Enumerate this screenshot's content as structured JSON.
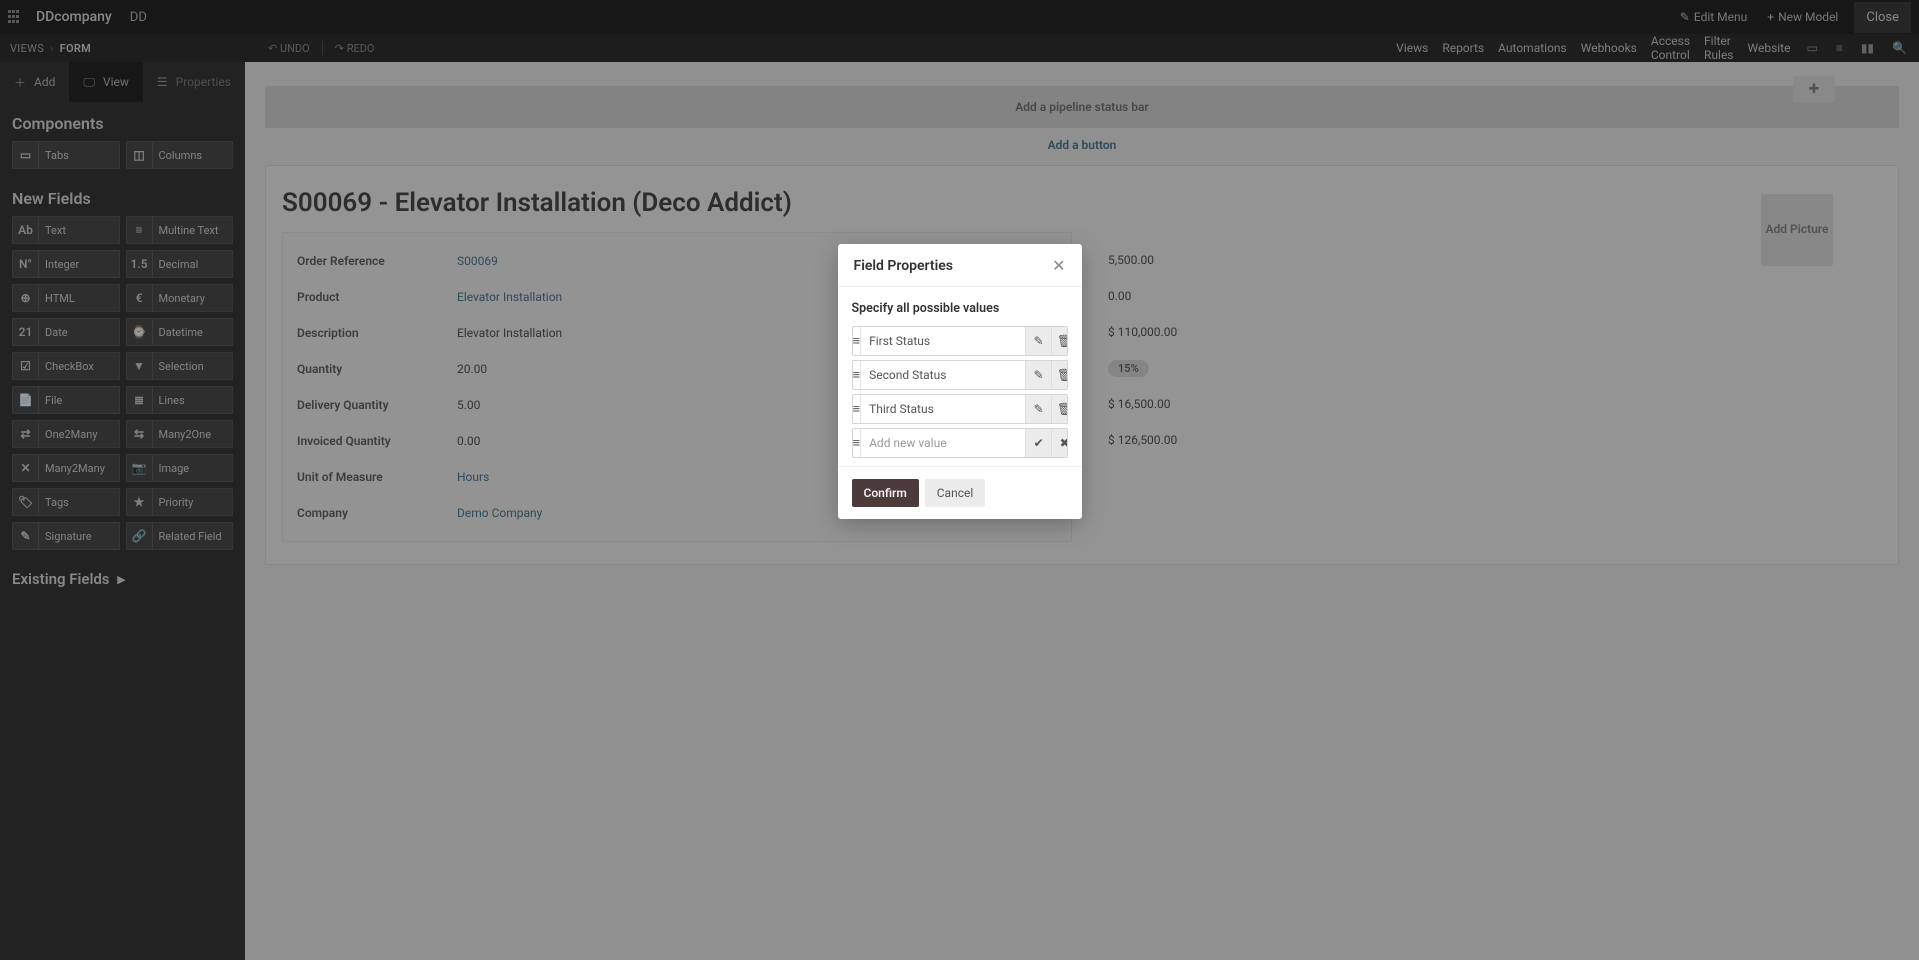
{
  "header": {
    "company": "DDcompany",
    "env": "DD",
    "edit_menu": "Edit Menu",
    "new_model": "New Model",
    "close": "Close"
  },
  "secondary": {
    "crumb_views": "VIEWS",
    "crumb_current": "FORM",
    "undo": "UNDO",
    "redo": "REDO",
    "links": [
      "Views",
      "Reports",
      "Automations",
      "Webhooks",
      "Access Control",
      "Filter Rules",
      "Website"
    ]
  },
  "sidebar": {
    "tabs": {
      "add": "Add",
      "view": "View",
      "properties": "Properties"
    },
    "components_title": "Components",
    "components": {
      "tabs": "Tabs",
      "columns": "Columns"
    },
    "new_fields_title": "New Fields",
    "fields": [
      {
        "icon": "Ab",
        "label": "Text"
      },
      {
        "icon": "≡",
        "label": "Multine Text"
      },
      {
        "icon": "N°",
        "label": "Integer"
      },
      {
        "icon": "1.5",
        "label": "Decimal"
      },
      {
        "icon": "⊕",
        "label": "HTML"
      },
      {
        "icon": "€",
        "label": "Monetary"
      },
      {
        "icon": "21",
        "label": "Date"
      },
      {
        "icon": "⌚",
        "label": "Datetime"
      },
      {
        "icon": "☑",
        "label": "CheckBox"
      },
      {
        "icon": "▼",
        "label": "Selection"
      },
      {
        "icon": "📄",
        "label": "File"
      },
      {
        "icon": "≣",
        "label": "Lines"
      },
      {
        "icon": "⇄",
        "label": "One2Many"
      },
      {
        "icon": "⇆",
        "label": "Many2One"
      },
      {
        "icon": "✕",
        "label": "Many2Many"
      },
      {
        "icon": "📷",
        "label": "Image"
      },
      {
        "icon": "🏷",
        "label": "Tags"
      },
      {
        "icon": "★",
        "label": "Priority"
      },
      {
        "icon": "✎",
        "label": "Signature"
      },
      {
        "icon": "🔗",
        "label": "Related Field"
      }
    ],
    "existing_fields": "Existing Fields"
  },
  "canvas": {
    "pipeline_hint": "Add a pipeline status bar",
    "add_button": "Add a button",
    "title": "S00069 - Elevator Installation (Deco Addict)",
    "add_picture": "Add Picture",
    "left_fields": [
      {
        "label": "Order Reference",
        "value": "S00069",
        "link": true
      },
      {
        "label": "Product",
        "value": "Elevator Installation",
        "link": true
      },
      {
        "label": "Description",
        "value": "Elevator Installation",
        "link": false
      },
      {
        "label": "Quantity",
        "value": "20.00",
        "link": false
      },
      {
        "label": "Delivery Quantity",
        "value": "5.00",
        "link": false
      },
      {
        "label": "Invoiced Quantity",
        "value": "0.00",
        "link": false
      },
      {
        "label": "Unit of Measure",
        "value": "Hours",
        "link": true
      },
      {
        "label": "Company",
        "value": "Demo Company",
        "link": true
      }
    ],
    "right_fields": [
      {
        "value": "5,500.00",
        "type": "text"
      },
      {
        "value": "0.00",
        "type": "text"
      },
      {
        "value": "$ 110,000.00",
        "type": "text"
      },
      {
        "value": "15%",
        "type": "badge"
      },
      {
        "value": "$ 16,500.00",
        "type": "text"
      },
      {
        "value": "$ 126,500.00",
        "type": "text"
      }
    ]
  },
  "modal": {
    "title": "Field Properties",
    "subtitle": "Specify all possible values",
    "values": [
      "First Status",
      "Second Status",
      "Third Status"
    ],
    "new_placeholder": "Add new value",
    "confirm": "Confirm",
    "cancel": "Cancel"
  }
}
